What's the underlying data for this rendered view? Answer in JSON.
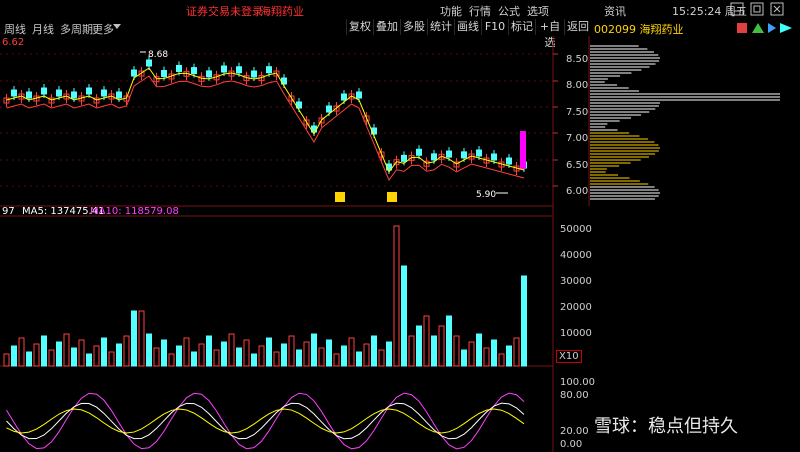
{
  "topbar": {
    "warning": "证券交易未登录",
    "stock_name": "海翔药业",
    "menu": [
      "功能",
      "行情",
      "公式",
      "选项",
      "资讯"
    ],
    "clock": "15:25:24 周五"
  },
  "tabs": [
    "周线",
    "月线",
    "多周期",
    "更多"
  ],
  "toolbar": [
    "复权",
    "叠加",
    "多股",
    "统计",
    "画线",
    "F10",
    "标记",
    "+自选",
    "返回"
  ],
  "stock_code_title": "002099 海翔药业",
  "price_top_label": "6.62",
  "price_axis": [
    "8.50",
    "8.00",
    "7.50",
    "7.00",
    "6.50",
    "6.00"
  ],
  "annotations": {
    "high": "8.68",
    "low": "5.90"
  },
  "volume_header": {
    "prefix": "97",
    "ma5": "MA5: 137475.41",
    "ma10": "MA10: 118579.08"
  },
  "volume_axis": [
    "50000",
    "40000",
    "30000",
    "20000",
    "10000"
  ],
  "volume_unit": "X10",
  "indicator_axis": [
    "100.00",
    "80.00",
    "20.00",
    "0.00"
  ],
  "watermark": "雪球：稳点但持久",
  "colors": {
    "up": "#ff4040",
    "down": "#54ffff",
    "ma5": "#ffffff",
    "ma10": "#ffff00",
    "ma_vol10": "#ff40ff"
  }
}
